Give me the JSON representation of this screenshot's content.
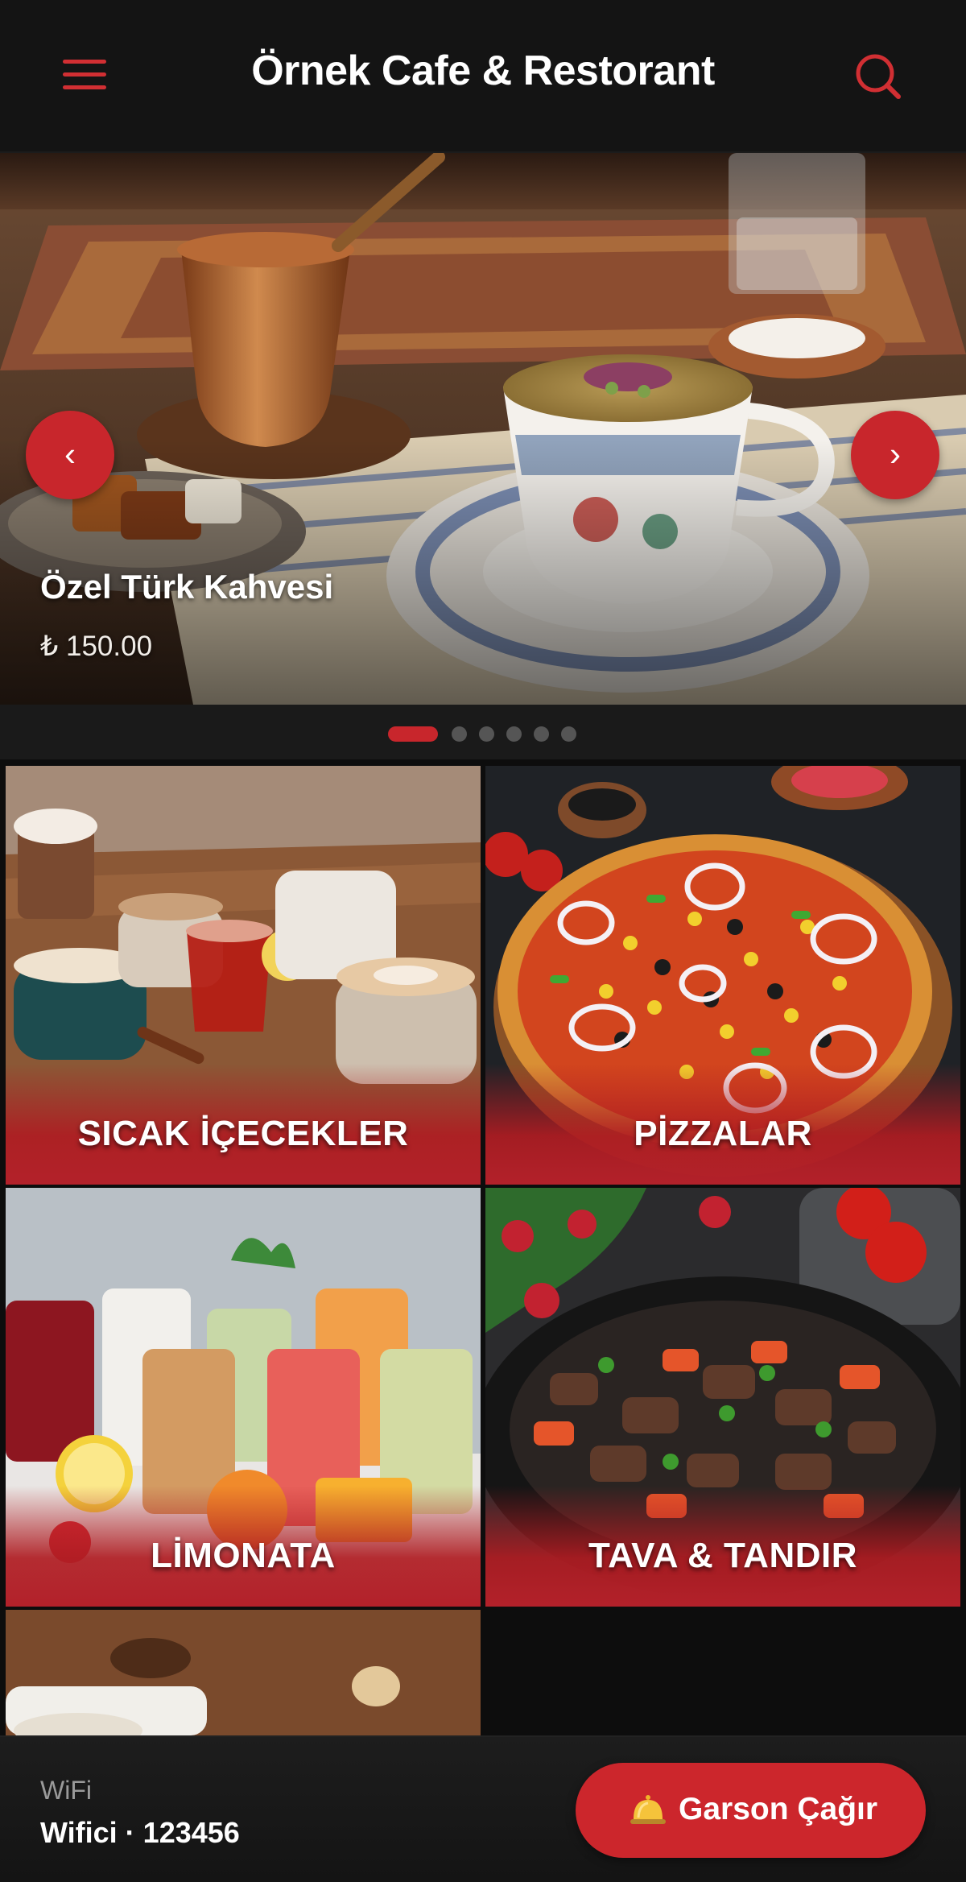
{
  "header": {
    "title": "Örnek Cafe & Restorant",
    "menu_icon": "hamburger-menu-icon",
    "search_icon": "search-icon",
    "accent_color": "#d12f33"
  },
  "slider": {
    "current": {
      "title": "Özel Türk Kahvesi",
      "price": "₺ 150.00"
    },
    "prev_glyph": "‹",
    "next_glyph": "›",
    "slide_count": 6,
    "active_index": 0
  },
  "categories": [
    {
      "label": "SICAK İÇECEKLER"
    },
    {
      "label": "PİZZALAR"
    },
    {
      "label": "LİMONATA"
    },
    {
      "label": "TAVA & TANDIR"
    },
    {
      "label": ""
    }
  ],
  "footer": {
    "wifi_label": "WiFi",
    "wifi_value": "Wifici · 123456",
    "waiter_button_label": "Garson Çağır",
    "bell_icon": "bell-icon"
  }
}
